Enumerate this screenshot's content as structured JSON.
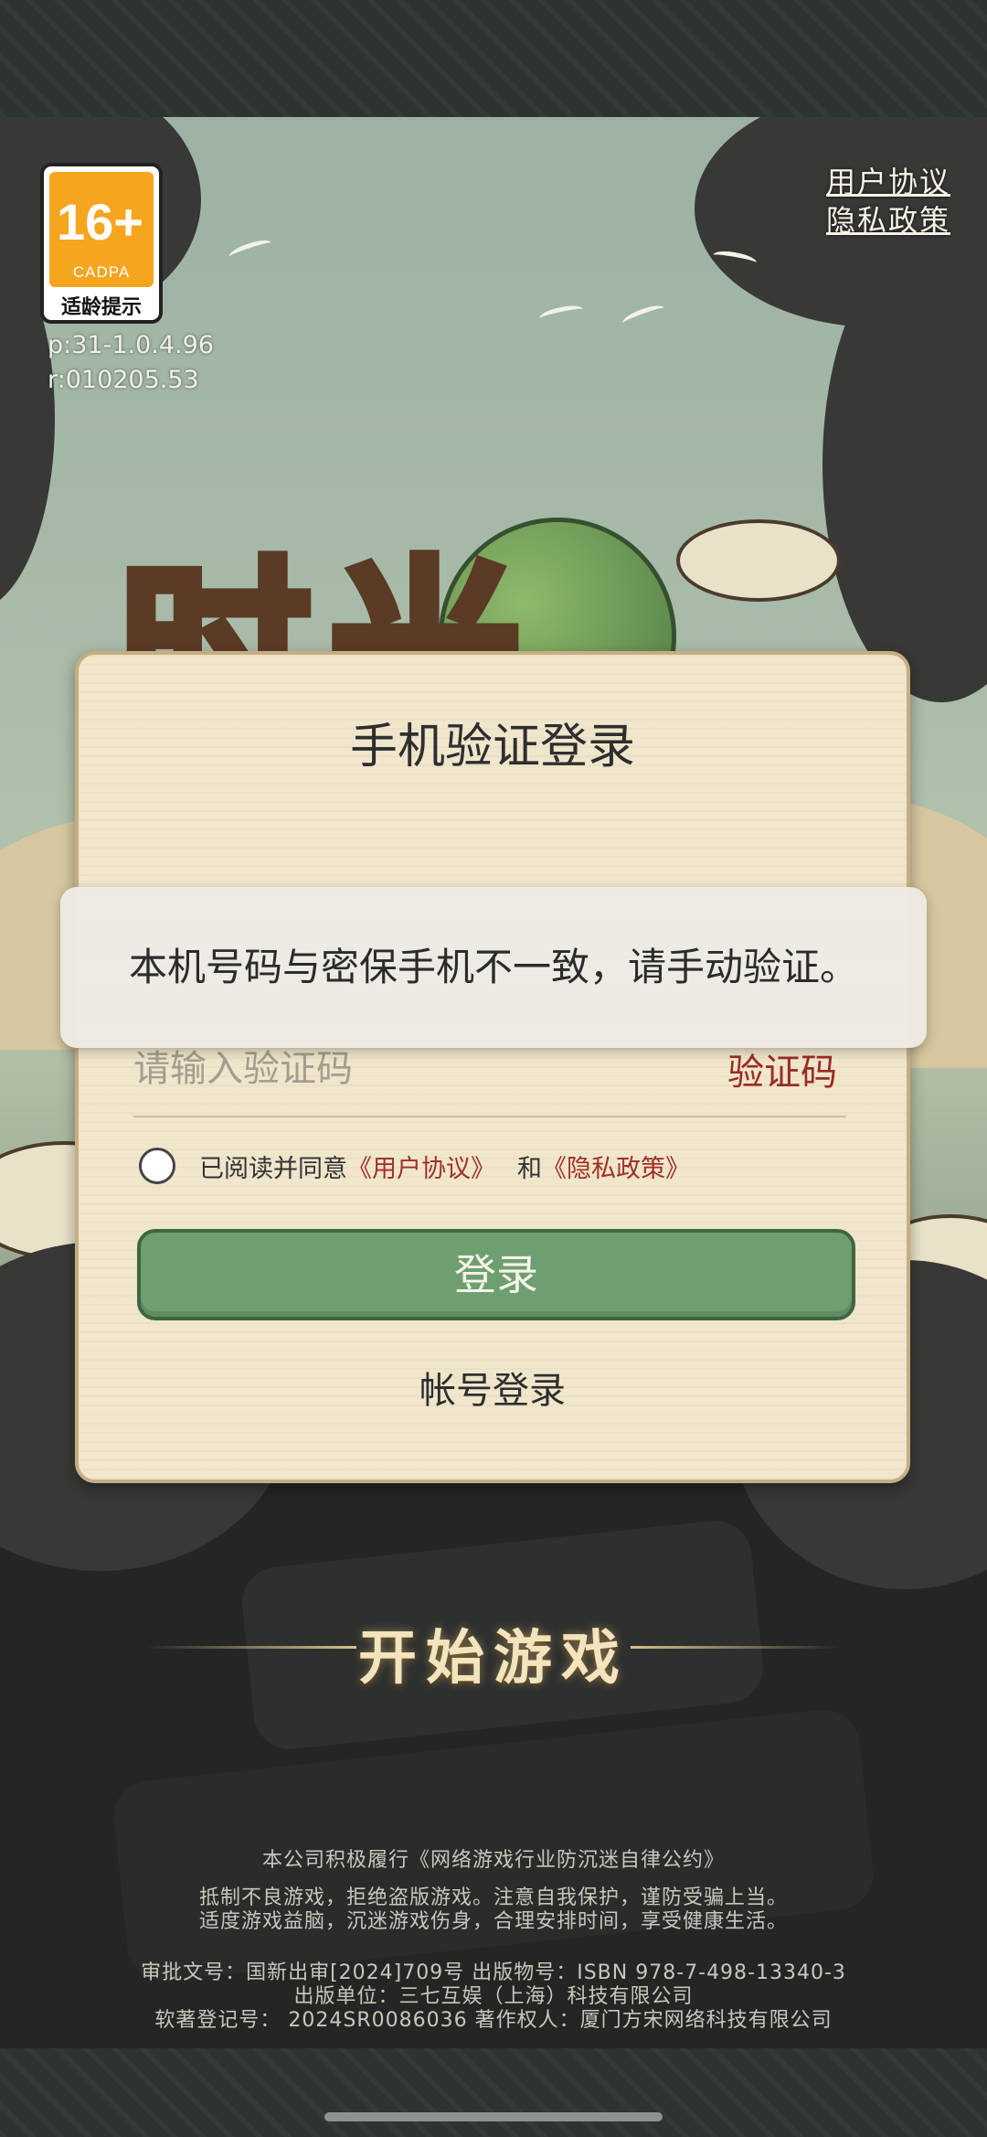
{
  "age_badge": {
    "age": "16+",
    "org": "CADPA",
    "label": "适龄提示"
  },
  "version": {
    "p": "p:31-1.0.4.96",
    "r": "r:010205.53"
  },
  "top_links": {
    "user_agreement": "用户协议",
    "privacy_policy": "隐私政策"
  },
  "game_logo": "时光",
  "dialog": {
    "title": "手机验证登录",
    "code_placeholder": "请输入验证码",
    "get_code": "验证码",
    "agree_prefix": "已阅读并同意",
    "agree_user_link": "《用户协议》",
    "agree_and": "和",
    "agree_privacy_link": "《隐私政策》",
    "login_button": "登录",
    "account_login": "帐号登录"
  },
  "toast": "本机号码与密保手机不一致，请手动验证。",
  "start_game": "开始游戏",
  "footer": {
    "line1": "本公司积极履行《网络游戏行业防沉迷自律公约》",
    "line2": "抵制不良游戏，拒绝盗版游戏。注意自我保护，谨防受骗上当。",
    "line3": "适度游戏益脑，沉迷游戏伤身，合理安排时间，享受健康生活。",
    "line4": "审批文号：国新出审[2024]709号 出版物号：ISBN 978-7-498-13340-3",
    "line5": "出版单位：三七互娱（上海）科技有限公司",
    "line6": "软著登记号： 2024SR0086036 著作权人：厦门方宋网络科技有限公司"
  }
}
